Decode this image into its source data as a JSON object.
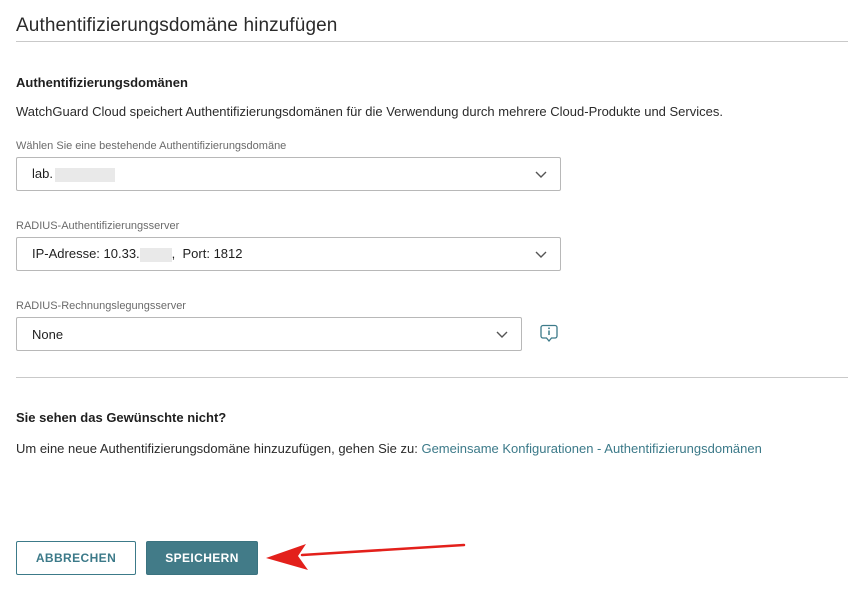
{
  "page": {
    "title": "Authentifizierungsdomäne hinzufügen"
  },
  "domains_section": {
    "heading": "Authentifizierungsdomänen",
    "description": "WatchGuard Cloud speichert Authentifizierungsdomänen für die Verwendung durch mehrere Cloud-Produkte und Services."
  },
  "fields": {
    "domain": {
      "label": "Wählen Sie eine bestehende Authentifizierungsdomäne",
      "value_prefix": "lab."
    },
    "radius_auth": {
      "label": "RADIUS-Authentifizierungsserver",
      "value_prefix": "IP-Adresse: 10.33.",
      "value_suffix": ",  Port: 1812"
    },
    "radius_accounting": {
      "label": "RADIUS-Rechnungslegungsserver",
      "value": "None"
    }
  },
  "help_section": {
    "heading": "Sie sehen das Gewünschte nicht?",
    "text": "Um eine neue Authentifizierungsdomäne hinzuzufügen, gehen Sie zu: ",
    "link": "Gemeinsame Konfigurationen - Authentifizierungsdomänen"
  },
  "buttons": {
    "cancel": "ABBRECHEN",
    "save": "SPEICHERN"
  },
  "colors": {
    "accent": "#427b88",
    "link": "#3c7a89",
    "annotation_arrow": "#e3201b"
  },
  "icons": {
    "select_chevron": "chevron-down-icon",
    "info": "info-icon",
    "annotation": "red-arrow-annotation"
  }
}
